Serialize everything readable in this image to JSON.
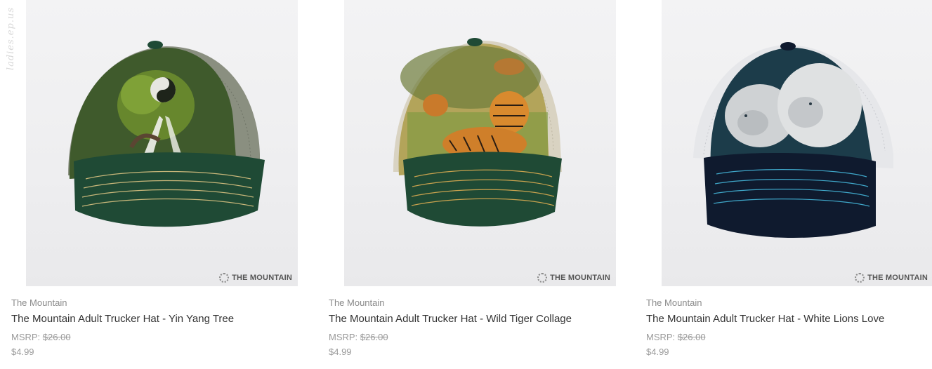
{
  "watermark": "ladies.ep.us",
  "brand_overlay": "THE MOUNTAIN",
  "products": [
    {
      "vendor": "The Mountain",
      "title": "The Mountain Adult Trucker Hat - Yin Yang Tree",
      "msrp_label": "MSRP:",
      "msrp_value": "$26.00",
      "price": "$4.99"
    },
    {
      "vendor": "The Mountain",
      "title": "The Mountain Adult Trucker Hat - Wild Tiger Collage",
      "msrp_label": "MSRP:",
      "msrp_value": "$26.00",
      "price": "$4.99"
    },
    {
      "vendor": "The Mountain",
      "title": "The Mountain Adult Trucker Hat - White Lions Love",
      "msrp_label": "MSRP:",
      "msrp_value": "$26.00",
      "price": "$4.99"
    }
  ],
  "colors": {
    "hat1_front": "#3f5a2c",
    "hat1_brim": "#1f4a35",
    "hat2_front": "#b3a45a",
    "hat2_brim": "#1f4a35",
    "hat3_front": "#1c3c4a",
    "hat3_brim": "#0f1a2e"
  }
}
